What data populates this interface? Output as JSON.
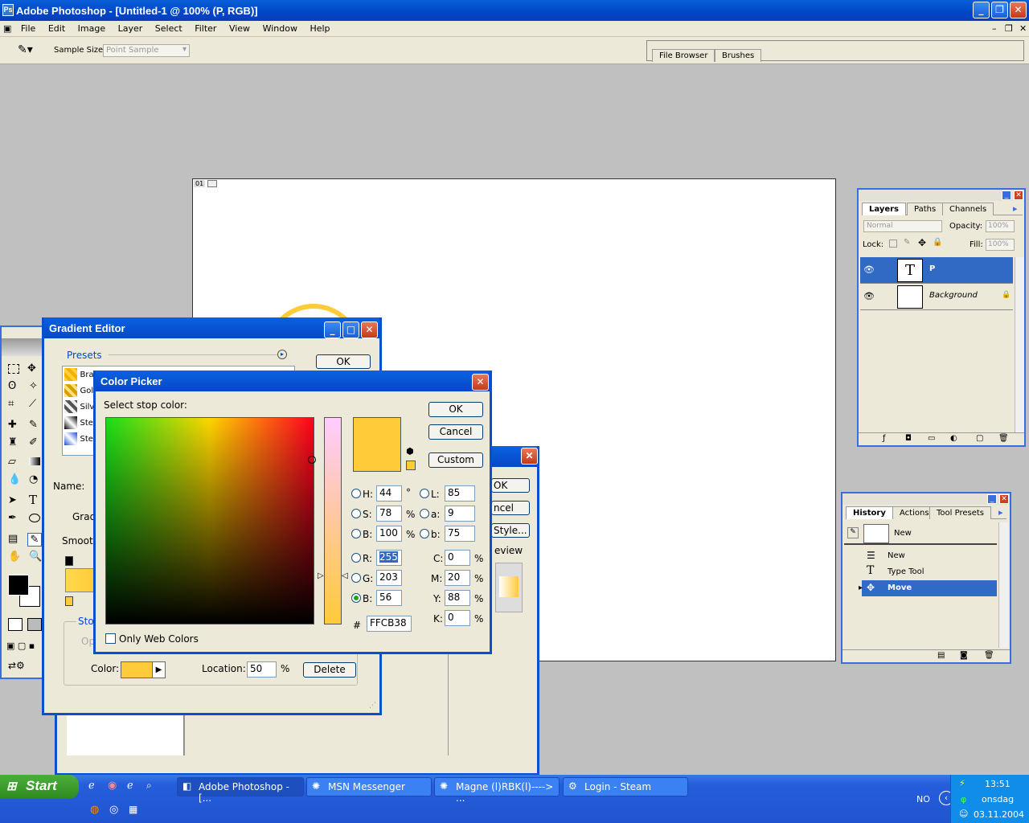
{
  "app": {
    "title": "Adobe Photoshop - [Untitled-1 @ 100% (P, RGB)]",
    "menus": [
      "File",
      "Edit",
      "Image",
      "Layer",
      "Select",
      "Filter",
      "View",
      "Window",
      "Help"
    ]
  },
  "options_bar": {
    "sample_size_label": "Sample Size:",
    "sample_size_value": "Point Sample",
    "well_tabs": [
      "File Browser",
      "Brushes"
    ]
  },
  "document": {
    "ruler_label": "01"
  },
  "layers_panel": {
    "tabs": [
      "Layers",
      "Paths",
      "Channels"
    ],
    "blend_mode": "Normal",
    "opacity_label": "Opacity:",
    "opacity_value": "100%",
    "lock_label": "Lock:",
    "fill_label": "Fill:",
    "fill_value": "100%",
    "layers": [
      {
        "name": "P",
        "thumb": "T",
        "selected": true
      },
      {
        "name": "Background",
        "thumb": "",
        "selected": false
      }
    ]
  },
  "history_panel": {
    "tabs": [
      "History",
      "Actions",
      "Tool Presets"
    ],
    "snapshot": "New",
    "items": [
      {
        "label": "New",
        "selected": false
      },
      {
        "label": "Type Tool",
        "selected": false
      },
      {
        "label": "Move",
        "selected": true
      }
    ]
  },
  "gradient_editor": {
    "title": "Gradient Editor",
    "presets_label": "Presets",
    "ok_label": "OK",
    "presets": [
      "Bra",
      "Gol",
      "Silv",
      "Ste",
      "Ste"
    ],
    "name_label": "Name:",
    "grad_label": "Grad",
    "smooth_label": "Smoot",
    "stops_label": "Stop",
    "opacity_short": "Op",
    "color_label": "Color:",
    "location_label": "Location:",
    "location_value": "50",
    "percent": "%",
    "delete_label": "Delete"
  },
  "layer_style_dialog": {
    "ok_fragment": "OK",
    "cancel_fragment": "ncel",
    "style_fragment": "Style...",
    "preview_fragment": "eview"
  },
  "color_picker": {
    "title": "Color Picker",
    "prompt": "Select stop color:",
    "ok_label": "OK",
    "cancel_label": "Cancel",
    "custom_label": "Custom",
    "hex_value": "FFCB38",
    "only_web_colors": "Only Web Colors",
    "new_color": "#ffcb38",
    "fields": {
      "H": "44",
      "S": "78",
      "B": "100",
      "R": "255",
      "G": "203",
      "Bv": "56",
      "L": "85",
      "a": "9",
      "b": "75",
      "C": "0",
      "M": "20",
      "Y": "88",
      "K": "0"
    },
    "units": {
      "deg": "°",
      "pct": "%"
    }
  },
  "taskbar": {
    "start_label": "Start",
    "items": [
      {
        "label": "Adobe Photoshop - [...",
        "active": true
      },
      {
        "label": "MSN Messenger",
        "active": false
      },
      {
        "label": "Magne (l)RBK(l)----> ...",
        "active": false
      },
      {
        "label": "Login - Steam",
        "active": false
      }
    ],
    "lang": "NO",
    "time": "13:51",
    "day": "onsdag",
    "date": "03.11.2004"
  },
  "colors": {
    "title_blue": "#0a5fd8",
    "selection_blue": "#316ac5",
    "picked_orange": "#ffcb38"
  }
}
